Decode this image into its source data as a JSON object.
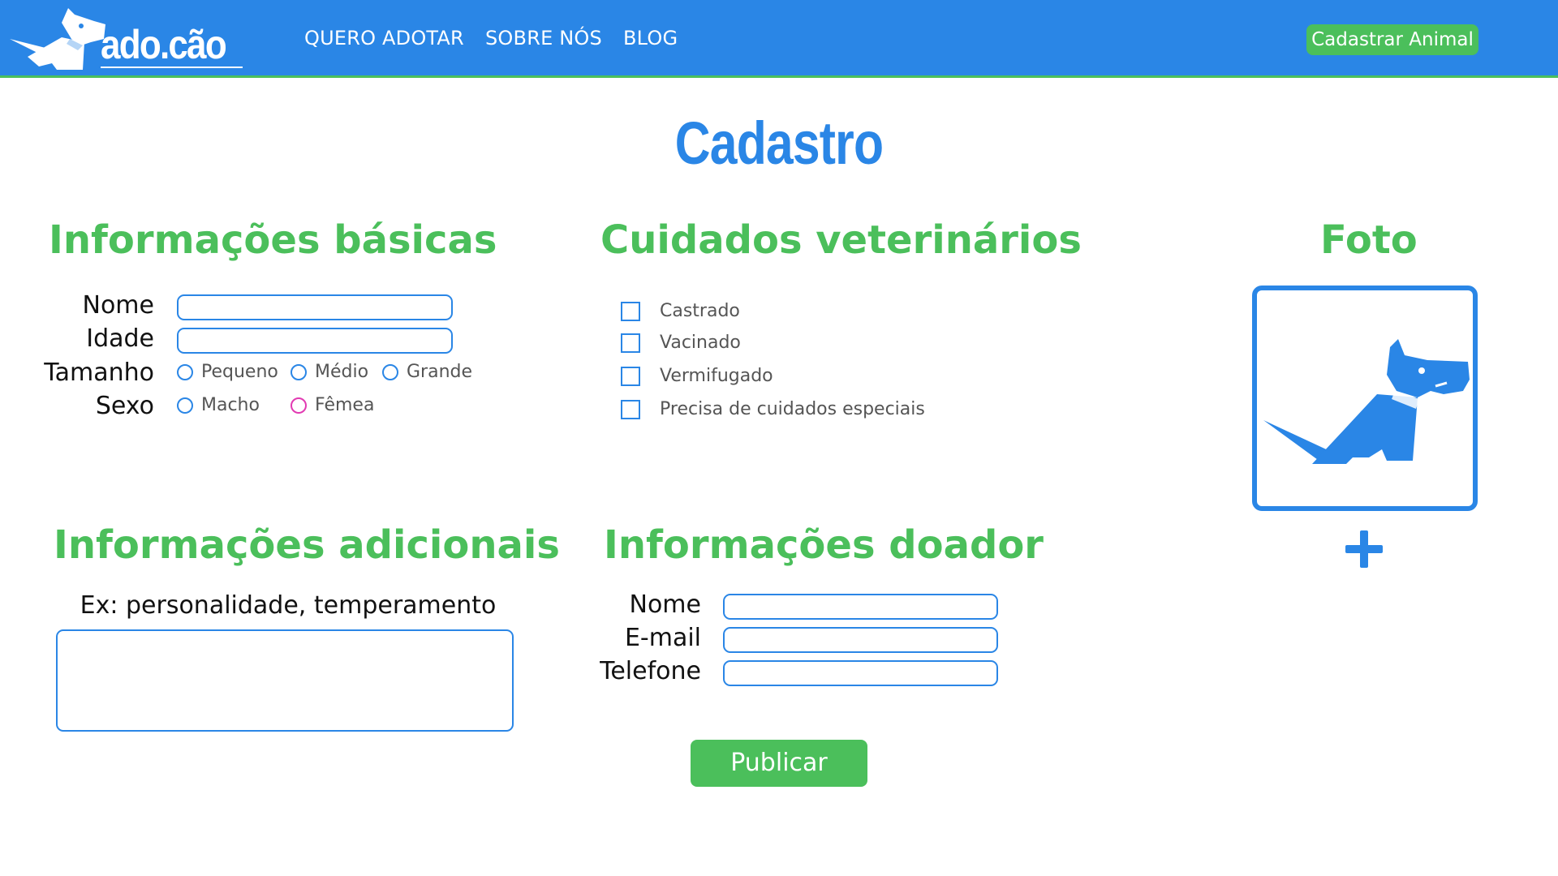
{
  "header": {
    "logo_text": "ado.cão",
    "nav": [
      "QUERO ADOTAR",
      "SOBRE NÓS",
      "BLOG"
    ],
    "cta_label": "Cadastrar Animal"
  },
  "page": {
    "title": "Cadastro"
  },
  "basic_info": {
    "title": "Informações básicas",
    "name_label": "Nome",
    "name_value": "",
    "age_label": "Idade",
    "age_value": "",
    "size_label": "Tamanho",
    "size_options": [
      "Pequeno",
      "Médio",
      "Grande"
    ],
    "sex_label": "Sexo",
    "sex_options": [
      "Macho",
      "Fêmea"
    ]
  },
  "vet_care": {
    "title": "Cuidados veterinários",
    "options": [
      "Castrado",
      "Vacinado",
      "Vermifugado",
      "Precisa de cuidados especiais"
    ]
  },
  "photo": {
    "title": "Foto",
    "placeholder_icon": "dog-icon",
    "add_icon": "plus-icon"
  },
  "extra_info": {
    "title": "Informações adicionais",
    "hint": "Ex: personalidade, temperamento",
    "value": ""
  },
  "donor_info": {
    "title": "Informações doador",
    "name_label": "Nome",
    "email_label": "E-mail",
    "phone_label": "Telefone",
    "name_value": "",
    "email_value": "",
    "phone_value": ""
  },
  "actions": {
    "publish_label": "Publicar"
  },
  "colors": {
    "primary_blue": "#2a86e6",
    "accent_green": "#4bbf5b",
    "female_pink": "#e23ab2"
  }
}
